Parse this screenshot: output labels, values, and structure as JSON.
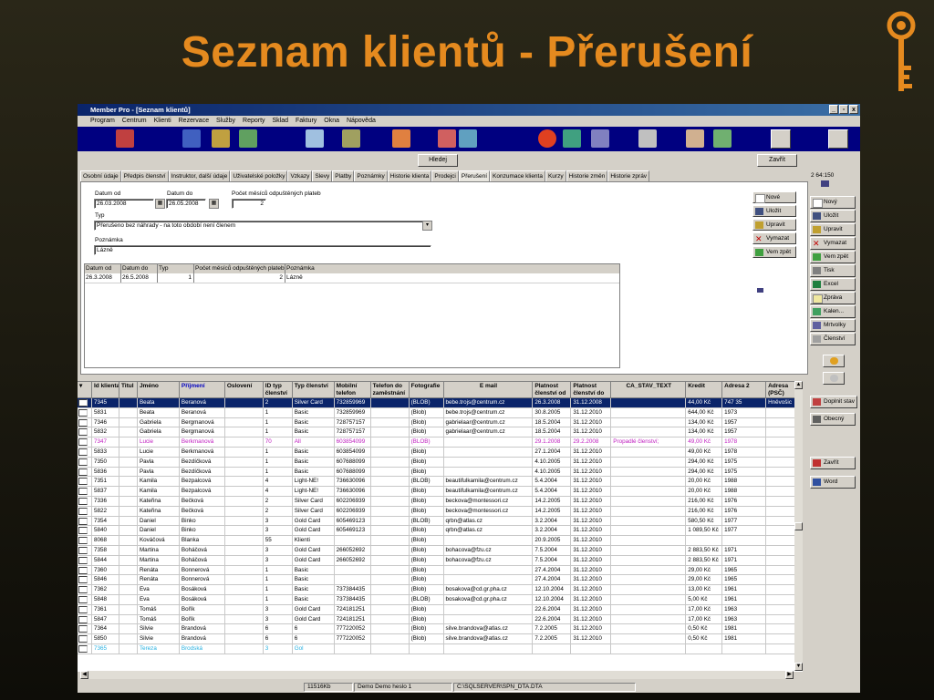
{
  "slide_title": "Seznam klientů - Přerušení",
  "window": {
    "title": "Member Pro - [Seznam klientů]",
    "buttons": [
      "_",
      "▫",
      "x"
    ]
  },
  "menu": [
    "Program",
    "Centrum",
    "Klienti",
    "Rezervace",
    "Služby",
    "Reporty",
    "Sklad",
    "Faktury",
    "Okna",
    "Nápověda"
  ],
  "toolbar_top": {
    "hledej": "Hledej",
    "zavrit": "Zavřít"
  },
  "tabs": [
    "Osobní údaje",
    "Předpis členství",
    "Instruktor, další údaje",
    "Uživatelské položky",
    "Vzkazy",
    "Slevy",
    "Platby",
    "Poznámky",
    "Historie klienta",
    "Prodejci",
    "Přerušení",
    "Konzumace klienta",
    "Kurzy",
    "Historie změn",
    "Historie zpráv"
  ],
  "form": {
    "datum_od_label": "Datum od",
    "datum_od_value": "26.03.2008",
    "datum_do_label": "Datum do",
    "datum_do_value": "26.05.2008",
    "pocet_label": "Počet měsíců odpuštěných plateb",
    "pocet_value": "2",
    "typ_label": "Typ",
    "typ_value": "Přerušeno bez náhrady - na toto období není členem",
    "poznamka_label": "Poznámka",
    "poznamka_value": "Lázně"
  },
  "inner_grid": {
    "headers": [
      "Datum od",
      "Datum do",
      "Typ",
      "Počet měsíců odpuštěných plateb",
      "Poznámka"
    ],
    "rows": [
      [
        "26.3.2008",
        "26.5.2008",
        "1",
        "2",
        "Lázně"
      ]
    ]
  },
  "panel_buttons": [
    "Nové",
    "Uložit",
    "Upravit",
    "Vymazat",
    "Vem zpět"
  ],
  "right_info": "2 64:150",
  "right_buttons": [
    "Nový",
    "Uložit",
    "Upravit",
    "Vymazat",
    "Vem zpět",
    "Tisk",
    "Excel",
    "Zpráva",
    "Kalen...",
    "Mrtvolky",
    "Členství"
  ],
  "right_buttons2": [
    "Doplnit stav",
    "Obecný",
    "Zavřít",
    "Word"
  ],
  "grid": {
    "headers": [
      "Id klienta",
      "Titul",
      "Jméno",
      "Příjmení",
      "Oslovení",
      "ID typ členství",
      "Typ členství",
      "Mobilní telefon",
      "Telefon do zaměstnání",
      "Fotografie",
      "E mail",
      "Platnost členství od",
      "Platnost členství do",
      "CA_STAV_TEXT",
      "Kredit",
      "Adresa 2",
      "Adresa (PSČ)"
    ],
    "rows": [
      [
        "7345",
        "",
        "Beata",
        "Beranová",
        "",
        "2",
        "Silver Card",
        "732859969",
        "",
        "(BLOB)",
        "bebe.trojs@centrum.cz",
        "26.3.2008",
        "31.12.2008",
        "",
        "44,00 Kč",
        "747 35",
        "Hněvošic"
      ],
      [
        "5831",
        "",
        "Beata",
        "Beranová",
        "",
        "1",
        "Basic",
        "732859969",
        "",
        "(Blob)",
        "bebe.trojs@centrum.cz",
        "30.8.2005",
        "31.12.2010",
        "",
        "644,00 Kč",
        "1973",
        ""
      ],
      [
        "7346",
        "",
        "Gabriela",
        "Bergmanová",
        "",
        "1",
        "Basic",
        "728757157",
        "",
        "(Blob)",
        "gabrielaar@centrum.cz",
        "18.5.2004",
        "31.12.2010",
        "",
        "134,00 Kč",
        "1957",
        ""
      ],
      [
        "5832",
        "",
        "Gabriela",
        "Bergmanová",
        "",
        "1",
        "Basic",
        "728757157",
        "",
        "(Blob)",
        "gabrielaar@centrum.cz",
        "18.5.2004",
        "31.12.2010",
        "",
        "134,00 Kč",
        "1957",
        ""
      ],
      [
        "7347",
        "",
        "Lucie",
        "Berkmanová",
        "",
        "70",
        "All",
        "603854099",
        "",
        "(BLOB)",
        "",
        "29.1.2008",
        "29.2.2008",
        "Propadlé členství;",
        "49,00 Kč",
        "1978",
        ""
      ],
      [
        "5833",
        "",
        "Lucie",
        "Berkmanová",
        "",
        "1",
        "Basic",
        "603854099",
        "",
        "(Blob)",
        "",
        "27.1.2004",
        "31.12.2010",
        "",
        "49,00 Kč",
        "1978",
        ""
      ],
      [
        "7350",
        "",
        "Pavla",
        "Bezdíčková",
        "",
        "1",
        "Basic",
        "607688099",
        "",
        "(Blob)",
        "",
        "4.10.2005",
        "31.12.2010",
        "",
        "294,00 Kč",
        "1975",
        ""
      ],
      [
        "5836",
        "",
        "Pavla",
        "Bezdíčková",
        "",
        "1",
        "Basic",
        "607688099",
        "",
        "(Blob)",
        "",
        "4.10.2005",
        "31.12.2010",
        "",
        "294,00 Kč",
        "1975",
        ""
      ],
      [
        "7351",
        "",
        "Kamila",
        "Bezpalcová",
        "",
        "4",
        "Light-NE!",
        "736630096",
        "",
        "(BLOB)",
        "beautifulkamila@centrum.cz",
        "5.4.2004",
        "31.12.2010",
        "",
        "20,00 Kč",
        "1988",
        ""
      ],
      [
        "5837",
        "",
        "Kamila",
        "Bezpalcová",
        "",
        "4",
        "Light-NE!",
        "736630096",
        "",
        "(Blob)",
        "beautifulkamila@centrum.cz",
        "5.4.2004",
        "31.12.2010",
        "",
        "20,00 Kč",
        "1988",
        ""
      ],
      [
        "7336",
        "",
        "Kateřina",
        "Bečková",
        "",
        "2",
        "Silver Card",
        "602206939",
        "",
        "(Blob)",
        "beckova@montessori.cz",
        "14.2.2005",
        "31.12.2010",
        "",
        "216,00 Kč",
        "1976",
        ""
      ],
      [
        "5822",
        "",
        "Kateřina",
        "Bečková",
        "",
        "2",
        "Silver Card",
        "602206939",
        "",
        "(Blob)",
        "beckova@montessori.cz",
        "14.2.2005",
        "31.12.2010",
        "",
        "216,00 Kč",
        "1976",
        ""
      ],
      [
        "7354",
        "",
        "Daniel",
        "Binko",
        "",
        "3",
        "Gold Card",
        "605469123",
        "",
        "(BLOB)",
        "qrbn@atlas.cz",
        "3.2.2004",
        "31.12.2010",
        "",
        "580,50 Kč",
        "1977",
        ""
      ],
      [
        "5840",
        "",
        "Daniel",
        "Binko",
        "",
        "3",
        "Gold Card",
        "605469123",
        "",
        "(Blob)",
        "qrbn@atlas.cz",
        "3.2.2004",
        "31.12.2010",
        "",
        "1 089,50 Kč",
        "1977",
        ""
      ],
      [
        "8068",
        "",
        "Kováčová",
        "Blanka",
        "",
        "55",
        "Klienti",
        "",
        "",
        "(Blob)",
        "",
        "20.9.2005",
        "31.12.2010",
        "",
        "",
        "",
        ""
      ],
      [
        "7358",
        "",
        "Martina",
        "Boháčová",
        "",
        "3",
        "Gold Card",
        "266052692",
        "",
        "(Blob)",
        "bohacova@fzu.cz",
        "7.5.2004",
        "31.12.2010",
        "",
        "2 883,50 Kč",
        "1971",
        ""
      ],
      [
        "5844",
        "",
        "Martina",
        "Boháčová",
        "",
        "3",
        "Gold Card",
        "266052692",
        "",
        "(Blob)",
        "bohacova@fzu.cz",
        "7.5.2004",
        "31.12.2010",
        "",
        "2 883,50 Kč",
        "1971",
        ""
      ],
      [
        "7360",
        "",
        "Renáta",
        "Bonnerová",
        "",
        "1",
        "Basic",
        "",
        "",
        "(Blob)",
        "",
        "27.4.2004",
        "31.12.2010",
        "",
        "29,00 Kč",
        "1965",
        ""
      ],
      [
        "5846",
        "",
        "Renáta",
        "Bonnerová",
        "",
        "1",
        "Basic",
        "",
        "",
        "(Blob)",
        "",
        "27.4.2004",
        "31.12.2010",
        "",
        "29,00 Kč",
        "1965",
        ""
      ],
      [
        "7362",
        "",
        "Eva",
        "Bosáková",
        "",
        "1",
        "Basic",
        "737384435",
        "",
        "(Blob)",
        "bosakova@cd.gr.pha.cz",
        "12.10.2004",
        "31.12.2010",
        "",
        "13,00 Kč",
        "1961",
        ""
      ],
      [
        "5848",
        "",
        "Eva",
        "Bosáková",
        "",
        "1",
        "Basic",
        "737384435",
        "",
        "(BLOB)",
        "bosakova@cd.gr.pha.cz",
        "12.10.2004",
        "31.12.2010",
        "",
        "5,00 Kč",
        "1961",
        ""
      ],
      [
        "7361",
        "",
        "Tomáš",
        "Bořík",
        "",
        "3",
        "Gold Card",
        "724181251",
        "",
        "(Blob)",
        "",
        "22.6.2004",
        "31.12.2010",
        "",
        "17,00 Kč",
        "1963",
        ""
      ],
      [
        "5847",
        "",
        "Tomáš",
        "Bořík",
        "",
        "3",
        "Gold Card",
        "724181251",
        "",
        "(Blob)",
        "",
        "22.6.2004",
        "31.12.2010",
        "",
        "17,00 Kč",
        "1963",
        ""
      ],
      [
        "7364",
        "",
        "Silvie",
        "Brandová",
        "",
        "6",
        "6",
        "777220052",
        "",
        "(Blob)",
        "silve.brandova@atlas.cz",
        "7.2.2005",
        "31.12.2010",
        "",
        "0,50 Kč",
        "1981",
        ""
      ],
      [
        "5850",
        "",
        "Silvie",
        "Brandová",
        "",
        "6",
        "6",
        "777220052",
        "",
        "(Blob)",
        "silve.brandova@atlas.cz",
        "7.2.2005",
        "31.12.2010",
        "",
        "0,50 Kč",
        "1981",
        ""
      ],
      [
        "7365",
        "",
        "Tereza",
        "Brodská",
        "",
        "3",
        "Gol",
        "",
        "",
        "",
        "",
        "",
        "",
        "",
        "",
        "",
        ""
      ]
    ]
  },
  "status": [
    "11516Kb",
    "Demo Demo heslo 1",
    "C:\\SQLSERVER\\SPN_DTA.DTA"
  ],
  "colors": {
    "accent": "#e58a1f",
    "toolbar": "#000080",
    "selection": "#0a246a"
  }
}
